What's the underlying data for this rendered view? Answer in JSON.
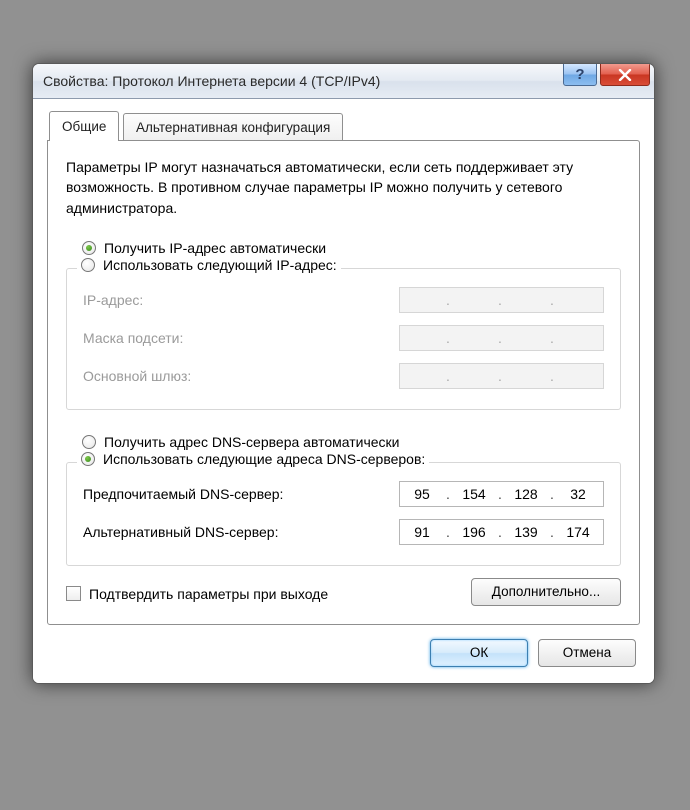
{
  "window": {
    "title": "Свойства: Протокол Интернета версии 4 (TCP/IPv4)"
  },
  "tabs": {
    "general": "Общие",
    "alternate": "Альтернативная конфигурация"
  },
  "description": "Параметры IP могут назначаться автоматически, если сеть поддерживает эту возможность. В противном случае параметры IP можно получить у сетевого администратора.",
  "ip_section": {
    "auto_label": "Получить IP-адрес автоматически",
    "manual_label": "Использовать следующий IP-адрес:",
    "ip_label": "IP-адрес:",
    "mask_label": "Маска подсети:",
    "gateway_label": "Основной шлюз:"
  },
  "dns_section": {
    "auto_label": "Получить адрес DNS-сервера автоматически",
    "manual_label": "Использовать следующие адреса DNS-серверов:",
    "preferred_label": "Предпочитаемый DNS-сервер:",
    "alternate_label": "Альтернативный DNS-сервер:",
    "preferred": {
      "o1": "95",
      "o2": "154",
      "o3": "128",
      "o4": "32"
    },
    "alternate": {
      "o1": "91",
      "o2": "196",
      "o3": "139",
      "o4": "174"
    }
  },
  "validate_label": "Подтвердить параметры при выходе",
  "buttons": {
    "advanced": "Дополнительно...",
    "ok": "ОК",
    "cancel": "Отмена"
  }
}
